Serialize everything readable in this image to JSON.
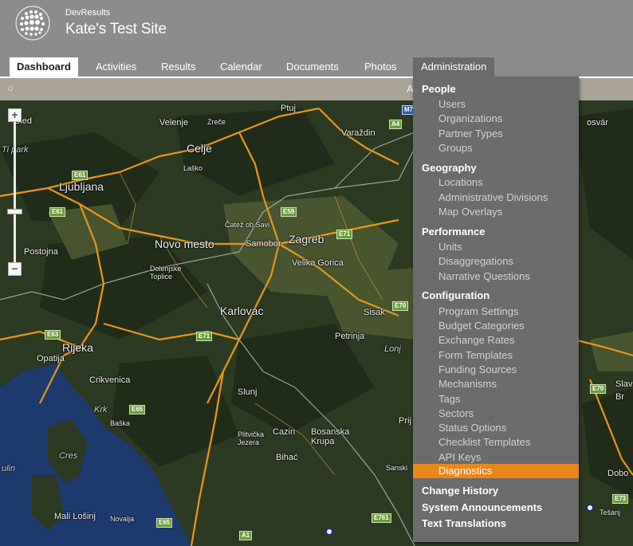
{
  "header": {
    "brand": "DevResults",
    "site_title": "Kate's Test Site"
  },
  "nav": {
    "tabs": [
      {
        "label": "Dashboard",
        "active": true
      },
      {
        "label": "Activities"
      },
      {
        "label": "Results"
      },
      {
        "label": "Calendar"
      },
      {
        "label": "Documents"
      },
      {
        "label": "Photos"
      },
      {
        "label": "Administration",
        "open": true
      }
    ]
  },
  "subbar": {
    "text": "A"
  },
  "map": {
    "zoom": {
      "plus": "+",
      "minus": "−",
      "thumb": "−"
    },
    "labels": [
      {
        "text": "Ptuj"
      },
      {
        "text": "Bled"
      },
      {
        "text": "Velenje"
      },
      {
        "text": "Zreče"
      },
      {
        "text": "Varaždin"
      },
      {
        "text": "Celje"
      },
      {
        "text": "Laško"
      },
      {
        "text": "Ljubljana"
      },
      {
        "text": "Čatež ob Savi"
      },
      {
        "text": "Novo mesto"
      },
      {
        "text": "Samobor"
      },
      {
        "text": "Zagreb"
      },
      {
        "text": "Postojna"
      },
      {
        "text": "Velika Gorica"
      },
      {
        "text": "Dolenjske Toplice"
      },
      {
        "text": "Karlovac"
      },
      {
        "text": "Sisak"
      },
      {
        "text": "Rijeka"
      },
      {
        "text": "Petrinja"
      },
      {
        "text": "Opatija"
      },
      {
        "text": "Lonj"
      },
      {
        "text": "Crikvenica"
      },
      {
        "text": "Slunj"
      },
      {
        "text": "Krk"
      },
      {
        "text": "Baška"
      },
      {
        "text": "Plitvička Jezera"
      },
      {
        "text": "Cazin"
      },
      {
        "text": "Bosanska Krupa"
      },
      {
        "text": "Bihać"
      },
      {
        "text": "Cres"
      },
      {
        "text": "ulin"
      },
      {
        "text": "Sanski"
      },
      {
        "text": "Prij"
      },
      {
        "text": "Mali Lošinj"
      },
      {
        "text": "Novalja"
      },
      {
        "text": "osvár"
      },
      {
        "text": "Slav"
      },
      {
        "text": "Br"
      },
      {
        "text": "Dobo"
      },
      {
        "text": "Tešanj"
      },
      {
        "text": "Ti park"
      }
    ],
    "roads": [
      "E61",
      "E61",
      "E59",
      "E71",
      "E70",
      "E63",
      "E71",
      "E65",
      "E65",
      "E761",
      "A1",
      "A4",
      "M7",
      "E70",
      "E73"
    ]
  },
  "menu": {
    "sections": [
      {
        "title": "People",
        "items": [
          "Users",
          "Organizations",
          "Partner Types",
          "Groups"
        ]
      },
      {
        "title": "Geography",
        "items": [
          "Locations",
          "Administrative Divisions",
          "Map Overlays"
        ]
      },
      {
        "title": "Performance",
        "items": [
          "Units",
          "Disaggregations",
          "Narrative Questions"
        ]
      },
      {
        "title": "Configuration",
        "items": [
          "Program Settings",
          "Budget Categories",
          "Exchange Rates",
          "Form Templates",
          "Funding Sources",
          "Mechanisms",
          "Tags",
          "Sectors",
          "Status Options",
          "Checklist Templates",
          "API Keys",
          "Diagnostics"
        ]
      }
    ],
    "highlighted": "Diagnostics",
    "footer_items": [
      "Change History",
      "System Announcements",
      "Text Translations"
    ]
  },
  "colors": {
    "header_bg": "#8c8c8c",
    "menu_bg": "#6b6b6b",
    "highlight": "#e8871e",
    "map_land": "#2c3a22",
    "map_sea": "#1d3b6e",
    "road": "#f0a020"
  }
}
